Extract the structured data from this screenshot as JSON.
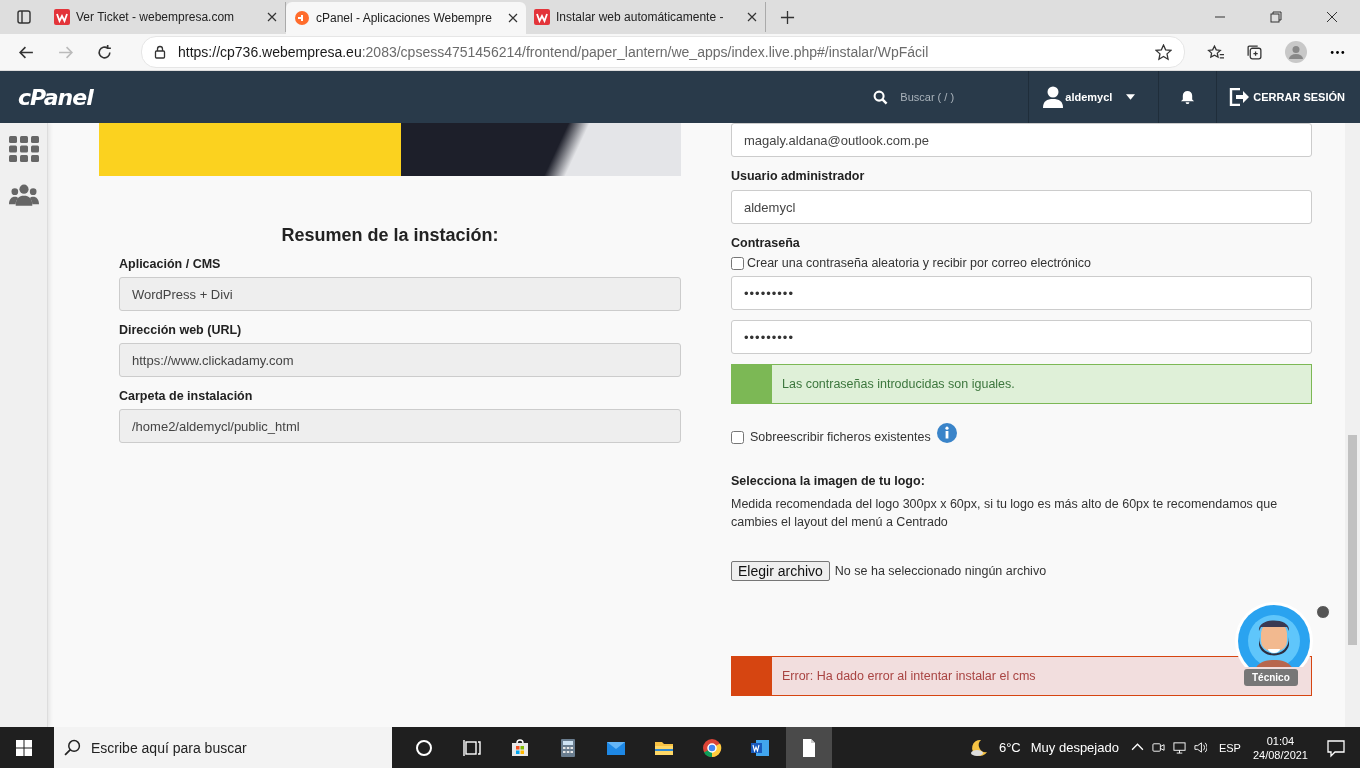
{
  "browser": {
    "tabs": [
      {
        "title": "Ver Ticket - webempresa.com",
        "selected": false,
        "kind": "webempresa"
      },
      {
        "title": "cPanel - Aplicaciones Webempre",
        "selected": true,
        "kind": "cpanel"
      },
      {
        "title": "Instalar web automáticamente -",
        "selected": false,
        "kind": "webempresa"
      }
    ],
    "url_host": "https://cp736.webempresa.eu",
    "url_rest": ":2083/cpsess4751456214/frontend/paper_lantern/we_apps/index.live.php#/instalar/WpFácil"
  },
  "header": {
    "logo": "cPanel",
    "search_placeholder": "Buscar ( / )",
    "user": "aldemycl",
    "logout": "CERRAR SESIÓN"
  },
  "summary": {
    "title": "Resumen de la instación:",
    "fields": [
      {
        "label": "Aplicación / CMS",
        "value": "WordPress  + Divi"
      },
      {
        "label": "Dirección web (URL)",
        "value": "https://www.clickadamy.com"
      },
      {
        "label": "Carpeta de instalación",
        "value": "/home2/aldemycl/public_html"
      }
    ]
  },
  "form": {
    "email_value": "magaly.aldana@outlook.com.pe",
    "admin_label": "Usuario administrador",
    "admin_value": "aldemycl",
    "password_label": "Contraseña",
    "random_password": {
      "label": "Crear una contraseña aleatoria y recibir por correo electrónico",
      "checked": false
    },
    "password_values": [
      "•••••••••",
      "•••••••••"
    ],
    "match_alert": {
      "kind": "success",
      "text": "Las contraseñas introducidas son iguales."
    },
    "overwrite": {
      "label": "Sobreescribir ficheros existentes",
      "checked": false
    },
    "logo_title": "Selecciona la imagen de tu logo:",
    "logo_description": "Medida recomendada del logo 300px x 60px, si tu logo es más alto de 60px te recomendamos que cambies el layout del menú a Centrado",
    "file_button": "Elegir archivo",
    "file_status": "No se ha seleccionado ningún archivo",
    "error_alert": {
      "kind": "error",
      "text": "Error: Ha dado error al intentar instalar el cms"
    }
  },
  "chat": {
    "label": "Técnico"
  },
  "taskbar": {
    "search_placeholder": "Escribe aquí para buscar",
    "temperature": "6°C",
    "weather": "Muy despejado",
    "language": "ESP",
    "time": "01:04",
    "date": "24/08/2021"
  }
}
